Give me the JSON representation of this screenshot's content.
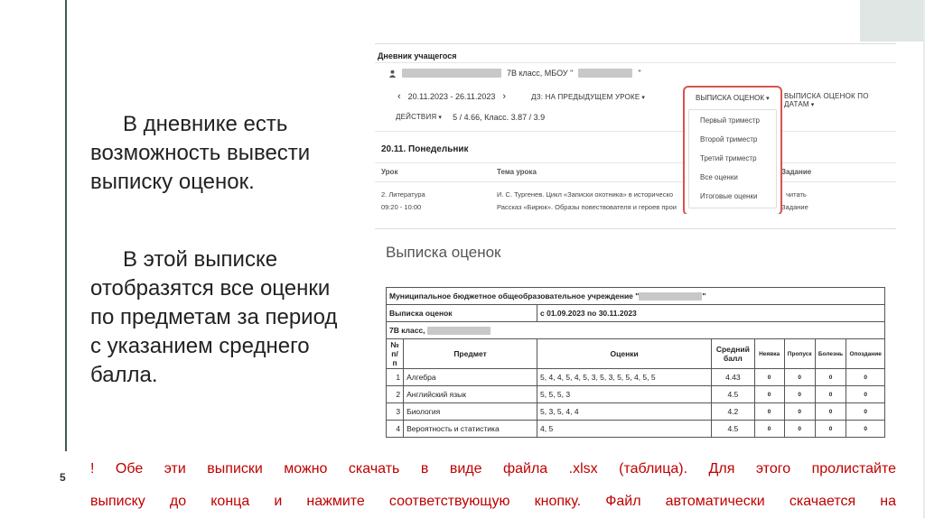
{
  "slide": {
    "page_number": "5",
    "paragraph1": "В дневнике есть возможность вывести выписку оценок.",
    "paragraph2": "В этой выписке отобразятся все оценки по предметам за период с указанием среднего балла.",
    "note_line1": "! Обе эти выписки можно скачать в виде файла .xlsx (таблица). Для этого пролистайте",
    "note_line2": "выписку до конца и нажмите соответствующую кнопку. Файл автоматически скачается на",
    "note_color": "#c00000"
  },
  "diary": {
    "title": "Дневник учащегося",
    "class_info": "7В класс, МБОУ \"",
    "class_info_end": "\"",
    "date_range": "20.11.2023 - 26.11.2023",
    "homework_dropdown": "ДЗ: НА ПРЕДЫДУЩЕМ УРОКЕ",
    "grades_dropdown": "ВЫПИСКА ОЦЕНОК",
    "grades_by_date": "ВЫПИСКА ОЦЕНОК ПО ДАТАМ",
    "actions": "ДЕЙСТВИЯ",
    "stats": "5 / 4.66, Класс. 3.87 / 3.9",
    "menu_items": [
      "Первый триместр",
      "Второй триместр",
      "Третий триместр",
      "Все оценки",
      "Итоговые оценки"
    ],
    "day_title": "20.11. Понедельник",
    "col_lesson": "Урок",
    "col_topic": "Тема урока",
    "col_task": "Задание",
    "lesson_name": "2. Литература",
    "lesson_time": "09:20 - 10:00",
    "topic_line1": "И. С. Тургенев. Цикл «Записки охотника» в историческо",
    "topic_line2": "Рассказ «Бирюк». Образы повествователя и героев прои",
    "task_line1": "читать",
    "task_line2": "Задание"
  },
  "grades": {
    "title": "Выписка оценок",
    "school": "Муниципальное бюджетное общеобразовательное учреждение \"",
    "school_end": "\"",
    "report_label": "Выписка оценок",
    "period": "с 01.09.2023 по 30.11.2023",
    "class_label": "7В класс,",
    "headers": {
      "num": "№ п/п",
      "subject": "Предмет",
      "grades": "Оценки",
      "avg": "Средний балл",
      "absent": "Неявка",
      "skip": "Пропуск",
      "ill": "Болезнь",
      "late": "Опоздание"
    },
    "rows": [
      {
        "num": "1",
        "subject": "Алгебра",
        "grades": "5, 4, 4, 5, 4, 5, 3, 5, 3, 5, 5, 4, 5, 5",
        "avg": "4.43",
        "absent": "0",
        "skip": "0",
        "ill": "0",
        "late": "0"
      },
      {
        "num": "2",
        "subject": "Английский язык",
        "grades": "5, 5, 5, 3",
        "avg": "4.5",
        "absent": "0",
        "skip": "0",
        "ill": "0",
        "late": "0"
      },
      {
        "num": "3",
        "subject": "Биология",
        "grades": "5, 3, 5, 4, 4",
        "avg": "4.2",
        "absent": "0",
        "skip": "0",
        "ill": "0",
        "late": "0"
      },
      {
        "num": "4",
        "subject": "Вероятность и статистика",
        "grades": "4, 5",
        "avg": "4.5",
        "absent": "0",
        "skip": "0",
        "ill": "0",
        "late": "0"
      }
    ]
  }
}
